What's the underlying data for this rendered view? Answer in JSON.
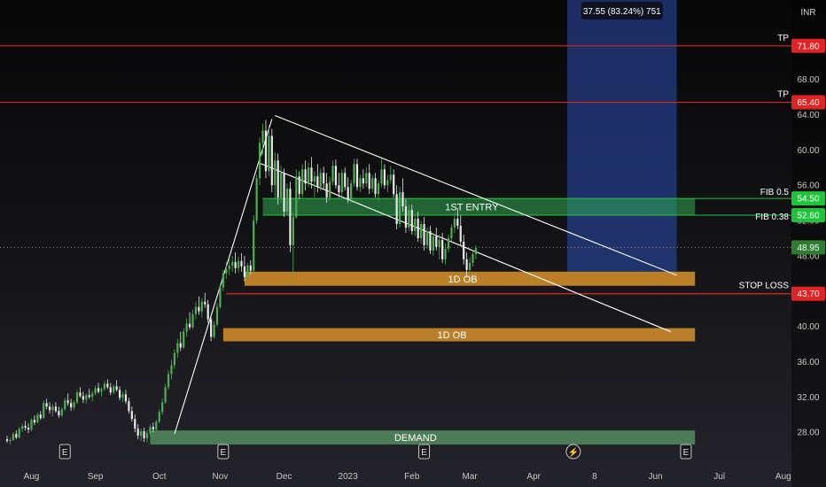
{
  "chart_data": {
    "type": "candlestick",
    "currency": "INR",
    "ylim": [
      25,
      77
    ],
    "y_ticks": [
      28,
      32,
      36,
      40,
      44,
      48,
      52,
      56,
      60,
      64,
      68
    ],
    "y_tick_labels": [
      "28.00",
      "32.00",
      "36.00",
      "40.00",
      "44.00",
      "48.00",
      "52.00",
      "56.00",
      "60.00",
      "64.00",
      "68.00"
    ],
    "x_labels": [
      {
        "label": "Aug",
        "bar": 8
      },
      {
        "label": "Sep",
        "bar": 29
      },
      {
        "label": "Oct",
        "bar": 50
      },
      {
        "label": "Nov",
        "bar": 70
      },
      {
        "label": "Dec",
        "bar": 91
      },
      {
        "label": "2023",
        "bar": 112
      },
      {
        "label": "Feb",
        "bar": 133
      },
      {
        "label": "Mar",
        "bar": 152
      },
      {
        "label": "Apr",
        "bar": 173
      },
      {
        "label": "8",
        "bar": 193
      },
      {
        "label": "Jun",
        "bar": 213
      },
      {
        "label": "Jul",
        "bar": 234
      },
      {
        "label": "Aug",
        "bar": 255
      }
    ],
    "bar_count_visible": 260,
    "candles": [
      [
        27.2,
        27.6,
        26.8,
        27.0
      ],
      [
        27.0,
        27.4,
        26.6,
        27.1
      ],
      [
        27.1,
        28.0,
        27.0,
        27.8
      ],
      [
        27.8,
        28.2,
        27.2,
        27.4
      ],
      [
        27.4,
        28.6,
        27.3,
        28.4
      ],
      [
        28.4,
        29.0,
        28.0,
        28.7
      ],
      [
        28.7,
        29.3,
        28.2,
        28.5
      ],
      [
        28.5,
        29.0,
        27.9,
        28.3
      ],
      [
        28.3,
        29.6,
        28.1,
        29.4
      ],
      [
        29.4,
        29.9,
        28.8,
        29.1
      ],
      [
        29.1,
        30.2,
        29.0,
        30.0
      ],
      [
        30.0,
        30.4,
        29.4,
        29.6
      ],
      [
        29.6,
        31.6,
        29.5,
        31.3
      ],
      [
        31.3,
        31.8,
        30.6,
        30.9
      ],
      [
        30.9,
        31.4,
        30.1,
        30.5
      ],
      [
        30.5,
        31.2,
        29.8,
        30.9
      ],
      [
        30.9,
        31.4,
        30.2,
        30.4
      ],
      [
        30.4,
        30.9,
        29.6,
        29.9
      ],
      [
        29.9,
        30.8,
        29.7,
        30.6
      ],
      [
        30.6,
        31.9,
        30.4,
        31.6
      ],
      [
        31.6,
        32.4,
        31.0,
        31.3
      ],
      [
        31.3,
        31.8,
        30.4,
        30.8
      ],
      [
        30.8,
        31.6,
        30.5,
        31.4
      ],
      [
        31.4,
        32.8,
        31.2,
        32.5
      ],
      [
        32.5,
        33.1,
        31.9,
        32.1
      ],
      [
        32.1,
        32.6,
        31.3,
        31.7
      ],
      [
        31.7,
        32.4,
        31.2,
        32.2
      ],
      [
        32.2,
        32.9,
        31.8,
        32.0
      ],
      [
        32.0,
        32.7,
        31.5,
        32.4
      ],
      [
        32.4,
        33.3,
        32.2,
        33.0
      ],
      [
        33.0,
        33.6,
        32.4,
        32.6
      ],
      [
        32.6,
        33.1,
        32.0,
        32.9
      ],
      [
        32.9,
        33.8,
        32.7,
        33.5
      ],
      [
        33.5,
        34.0,
        32.9,
        33.1
      ],
      [
        33.1,
        33.6,
        32.2,
        32.5
      ],
      [
        32.5,
        33.4,
        32.3,
        33.2
      ],
      [
        33.2,
        33.9,
        32.6,
        32.8
      ],
      [
        32.8,
        33.2,
        31.6,
        31.9
      ],
      [
        31.9,
        32.6,
        31.4,
        32.3
      ],
      [
        32.3,
        32.8,
        31.2,
        31.5
      ],
      [
        31.5,
        31.9,
        30.1,
        30.4
      ],
      [
        30.4,
        30.9,
        29.2,
        29.5
      ],
      [
        29.5,
        30.0,
        28.0,
        28.4
      ],
      [
        28.4,
        28.9,
        27.2,
        27.6
      ],
      [
        27.6,
        28.4,
        27.0,
        28.1
      ],
      [
        28.1,
        28.5,
        26.9,
        27.3
      ],
      [
        27.3,
        28.2,
        26.8,
        27.9
      ],
      [
        27.9,
        28.9,
        27.6,
        28.6
      ],
      [
        28.6,
        29.1,
        28.0,
        28.3
      ],
      [
        28.3,
        29.4,
        28.1,
        29.2
      ],
      [
        29.2,
        30.6,
        29.0,
        30.3
      ],
      [
        30.3,
        31.8,
        30.0,
        31.4
      ],
      [
        31.4,
        33.5,
        31.2,
        33.1
      ],
      [
        33.1,
        35.0,
        32.8,
        34.6
      ],
      [
        34.6,
        36.2,
        34.0,
        35.6
      ],
      [
        35.6,
        37.4,
        35.2,
        37.0
      ],
      [
        37.0,
        38.6,
        36.4,
        38.1
      ],
      [
        38.1,
        39.4,
        37.2,
        37.6
      ],
      [
        37.6,
        39.8,
        37.4,
        39.4
      ],
      [
        39.4,
        40.9,
        38.8,
        40.3
      ],
      [
        40.3,
        41.6,
        39.6,
        39.9
      ],
      [
        39.9,
        41.9,
        39.7,
        41.4
      ],
      [
        41.4,
        42.8,
        40.8,
        42.2
      ],
      [
        42.2,
        43.4,
        41.3,
        41.7
      ],
      [
        41.7,
        43.2,
        41.0,
        42.8
      ],
      [
        42.8,
        43.8,
        42.1,
        42.5
      ],
      [
        42.5,
        43.0,
        40.4,
        40.8
      ],
      [
        40.8,
        41.2,
        38.3,
        38.8
      ],
      [
        38.8,
        40.6,
        38.6,
        40.2
      ],
      [
        40.2,
        42.6,
        40.0,
        42.2
      ],
      [
        42.2,
        44.8,
        42.0,
        44.4
      ],
      [
        44.4,
        46.4,
        44.0,
        46.0
      ],
      [
        46.0,
        47.3,
        45.4,
        46.5
      ],
      [
        46.5,
        47.6,
        45.8,
        46.9
      ],
      [
        46.9,
        48.0,
        46.2,
        47.3
      ],
      [
        47.3,
        48.4,
        46.0,
        46.6
      ],
      [
        46.6,
        47.9,
        46.1,
        47.4
      ],
      [
        47.4,
        48.3,
        46.2,
        46.8
      ],
      [
        46.8,
        48.0,
        45.1,
        45.6
      ],
      [
        45.6,
        47.2,
        45.4,
        46.9
      ],
      [
        46.9,
        47.5,
        45.9,
        46.3
      ],
      [
        46.3,
        52.6,
        46.2,
        52.0
      ],
      [
        52.0,
        57.2,
        51.6,
        56.8
      ],
      [
        56.8,
        61.4,
        56.0,
        60.8
      ],
      [
        60.8,
        63.0,
        59.4,
        62.2
      ],
      [
        62.2,
        63.4,
        56.8,
        57.6
      ],
      [
        57.6,
        62.8,
        57.0,
        61.6
      ],
      [
        61.6,
        62.4,
        55.2,
        56.0
      ],
      [
        56.0,
        59.8,
        54.4,
        58.8
      ],
      [
        58.8,
        59.6,
        53.8,
        54.6
      ],
      [
        54.6,
        58.2,
        54.0,
        57.4
      ],
      [
        57.4,
        57.9,
        52.4,
        53.0
      ],
      [
        53.0,
        56.2,
        52.6,
        55.6
      ],
      [
        55.6,
        56.4,
        48.4,
        49.2
      ],
      [
        49.2,
        53.0,
        45.8,
        52.4
      ],
      [
        52.4,
        57.8,
        52.2,
        57.0
      ],
      [
        57.0,
        57.6,
        54.4,
        55.0
      ],
      [
        55.0,
        58.4,
        54.6,
        57.8
      ],
      [
        57.8,
        58.8,
        55.4,
        56.2
      ],
      [
        56.2,
        58.6,
        55.8,
        58.0
      ],
      [
        58.0,
        59.2,
        55.6,
        56.4
      ],
      [
        56.4,
        57.6,
        54.6,
        57.0
      ],
      [
        57.0,
        58.4,
        55.2,
        55.8
      ],
      [
        55.8,
        57.9,
        55.4,
        57.4
      ],
      [
        57.4,
        58.1,
        55.6,
        56.2
      ],
      [
        56.2,
        57.4,
        54.0,
        54.6
      ],
      [
        54.6,
        57.0,
        54.2,
        56.4
      ],
      [
        56.4,
        58.8,
        56.0,
        58.2
      ],
      [
        58.2,
        58.9,
        55.6,
        56.0
      ],
      [
        56.0,
        57.4,
        54.6,
        55.2
      ],
      [
        55.2,
        57.8,
        54.8,
        57.4
      ],
      [
        57.4,
        58.0,
        55.4,
        55.8
      ],
      [
        55.8,
        56.9,
        54.0,
        54.4
      ],
      [
        54.4,
        56.6,
        54.0,
        56.2
      ],
      [
        56.2,
        59.0,
        55.8,
        58.4
      ],
      [
        58.4,
        59.0,
        55.4,
        55.8
      ],
      [
        55.8,
        57.2,
        55.2,
        56.8
      ],
      [
        56.8,
        57.8,
        55.6,
        56.2
      ],
      [
        56.2,
        58.0,
        55.8,
        57.4
      ],
      [
        57.4,
        58.4,
        55.0,
        55.6
      ],
      [
        55.6,
        57.2,
        55.2,
        56.8
      ],
      [
        56.8,
        57.4,
        54.6,
        55.0
      ],
      [
        55.0,
        56.6,
        54.2,
        56.2
      ],
      [
        56.2,
        59.0,
        55.8,
        57.8
      ],
      [
        57.8,
        58.4,
        55.6,
        56.0
      ],
      [
        56.0,
        57.2,
        55.2,
        56.6
      ],
      [
        56.6,
        58.2,
        56.2,
        57.2
      ],
      [
        57.2,
        57.8,
        54.6,
        55.0
      ],
      [
        55.0,
        56.0,
        51.0,
        51.6
      ],
      [
        51.6,
        55.8,
        51.2,
        55.2
      ],
      [
        55.2,
        56.8,
        53.0,
        53.6
      ],
      [
        53.6,
        54.4,
        50.6,
        51.2
      ],
      [
        51.2,
        53.8,
        50.8,
        53.2
      ],
      [
        53.2,
        53.8,
        50.4,
        50.8
      ],
      [
        50.8,
        52.6,
        50.2,
        52.2
      ],
      [
        52.2,
        53.0,
        49.6,
        50.0
      ],
      [
        50.0,
        52.0,
        49.4,
        51.6
      ],
      [
        51.6,
        52.4,
        48.6,
        49.2
      ],
      [
        49.2,
        51.2,
        48.8,
        50.8
      ],
      [
        50.8,
        51.4,
        48.2,
        48.6
      ],
      [
        48.6,
        50.6,
        48.0,
        50.2
      ],
      [
        50.2,
        51.2,
        48.6,
        49.0
      ],
      [
        49.0,
        50.4,
        47.6,
        49.8
      ],
      [
        49.8,
        50.6,
        47.2,
        47.6
      ],
      [
        47.6,
        49.4,
        47.0,
        48.8
      ],
      [
        48.8,
        50.4,
        48.4,
        50.0
      ],
      [
        50.0,
        51.6,
        49.6,
        51.2
      ],
      [
        51.2,
        52.8,
        50.6,
        52.2
      ],
      [
        52.2,
        53.4,
        51.0,
        51.4
      ],
      [
        51.4,
        52.6,
        49.2,
        49.6
      ],
      [
        49.6,
        50.4,
        47.0,
        47.6
      ],
      [
        47.6,
        48.4,
        45.6,
        46.4
      ],
      [
        46.4,
        47.8,
        45.8,
        47.2
      ],
      [
        47.2,
        48.6,
        46.8,
        48.2
      ],
      [
        48.2,
        49.2,
        47.6,
        48.9
      ]
    ],
    "annotations": {
      "trendlines": [
        {
          "name": "upper-channel",
          "from": {
            "bar": 88,
            "price": 63.9
          },
          "to": {
            "bar": 220,
            "price": 45.8
          }
        },
        {
          "name": "lower-channel",
          "from": {
            "bar": 83,
            "price": 58.5
          },
          "to": {
            "bar": 218,
            "price": 39.4
          }
        },
        {
          "name": "rally-line",
          "from": {
            "bar": 55,
            "price": 27.8
          },
          "to": {
            "bar": 87,
            "price": 63.5
          }
        }
      ],
      "zones": [
        {
          "label": "1ST ENTRY",
          "from_bar": 84,
          "to_bar": 226,
          "top": 54.5,
          "bottom": 52.6,
          "color": "#2fa84f",
          "alpha": 0.55
        },
        {
          "label": "1D OB",
          "from_bar": 78,
          "to_bar": 226,
          "top": 46.2,
          "bottom": 44.6,
          "color": "#d8922c",
          "alpha": 0.85
        },
        {
          "label": "1D OB",
          "from_bar": 71,
          "to_bar": 226,
          "top": 39.8,
          "bottom": 38.3,
          "color": "#d8922c",
          "alpha": 0.85
        },
        {
          "label": "DEMAND",
          "from_bar": 47,
          "to_bar": 226,
          "top": 28.2,
          "bottom": 26.6,
          "color": "#5ea46a",
          "alpha": 0.7
        }
      ],
      "levels": [
        {
          "label": "TP",
          "price": 71.8,
          "price_label": "71.80",
          "color": "#e02424"
        },
        {
          "label": "TP",
          "price": 65.4,
          "price_label": "65.40",
          "color": "#e02424"
        },
        {
          "label": "STOP LOSS",
          "price": 43.7,
          "price_label": "43.70",
          "color": "#e02424",
          "from_bar": 72
        }
      ],
      "fib": [
        {
          "label": "FIB 0.5",
          "price": 54.5,
          "price_label": "54.50",
          "color": "#20c43a"
        },
        {
          "label": "FIB 0.38",
          "price": 52.6,
          "price_label": "52.60",
          "color": "#20c43a"
        }
      ],
      "current_price": {
        "price": 48.95,
        "label": "48.95"
      },
      "projection": {
        "from_bar": 184,
        "to_bar": 220,
        "top": 77,
        "bottom": 46.2,
        "label": "37.55 (83.24%) 751"
      },
      "event_markers": [
        {
          "bar": 19,
          "glyph": "E"
        },
        {
          "bar": 71,
          "glyph": "E"
        },
        {
          "bar": 137,
          "glyph": "E"
        },
        {
          "bar": 186,
          "glyph": "⚡"
        },
        {
          "bar": 223,
          "glyph": "E"
        }
      ]
    }
  }
}
